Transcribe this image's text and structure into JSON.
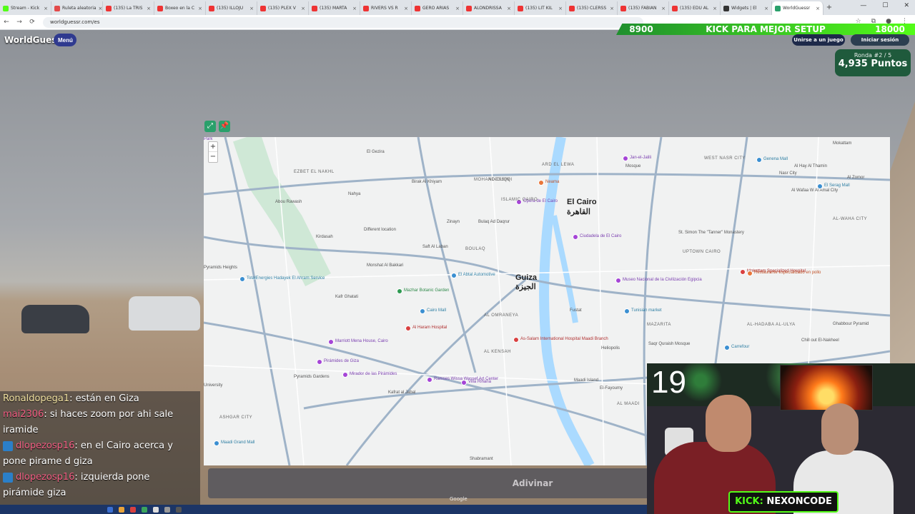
{
  "browser": {
    "tabs": [
      {
        "label": "Stream - Kick",
        "color": "#53fc18"
      },
      {
        "label": "Ruleta aleatoria",
        "color": "#e34a4a"
      },
      {
        "label": "(135) La TRIS",
        "color": "#e33"
      },
      {
        "label": "Boxeo en la C",
        "color": "#e33"
      },
      {
        "label": "(135) ILLOJU",
        "color": "#e33"
      },
      {
        "label": "(135) PLEX V",
        "color": "#e33"
      },
      {
        "label": "(135) MARTA",
        "color": "#e33"
      },
      {
        "label": "RIVERS VS R",
        "color": "#e33"
      },
      {
        "label": "GERO ARIAS",
        "color": "#e33"
      },
      {
        "label": "ALONDRISSA",
        "color": "#e33"
      },
      {
        "label": "(135) LIT KIL",
        "color": "#e33"
      },
      {
        "label": "(135) CLERSS",
        "color": "#e33"
      },
      {
        "label": "(135) FABIAN",
        "color": "#e33"
      },
      {
        "label": "(135) EDU AL",
        "color": "#e33"
      },
      {
        "label": "Widgets | El",
        "color": "#333"
      },
      {
        "label": "WorldGuessr",
        "color": "#2aa06b"
      }
    ],
    "url": "worldguessr.com/es"
  },
  "game": {
    "logo": "WorldGuessr",
    "menu_label": "Menú",
    "join_label": "Unirse a un juego",
    "login_label": "Iniciar sesión",
    "round_label": "Ronda #2 / 5",
    "points": "4,935 Puntos",
    "guess_label": "Adivinar",
    "google": "Google"
  },
  "kick_bar": {
    "left": "8900",
    "text": "KICK PARA MEJOR SETUP",
    "right": "18000"
  },
  "map": {
    "labels": [
      {
        "t": "El Cairo",
        "c": "big"
      },
      {
        "t": "القاهرة",
        "c": "big"
      },
      {
        "t": "Guiza",
        "c": "big"
      },
      {
        "t": "الجيزة",
        "c": "big"
      },
      {
        "t": "EZBET EL NAKHL",
        "c": "district"
      },
      {
        "t": "Abou Rawash",
        "c": ""
      },
      {
        "t": "Nahya",
        "c": ""
      },
      {
        "t": "Birak Al Khiyam",
        "c": ""
      },
      {
        "t": "Kirdasah",
        "c": ""
      },
      {
        "t": "Different location",
        "c": ""
      },
      {
        "t": "Zinayn",
        "c": ""
      },
      {
        "t": "Bulaq Ad Daqrur",
        "c": ""
      },
      {
        "t": "Saft Al Laban",
        "c": ""
      },
      {
        "t": "BOULAQ",
        "c": "district"
      },
      {
        "t": "Monshat Al Bakkari",
        "c": ""
      },
      {
        "t": "Kafr Ghatati",
        "c": ""
      },
      {
        "t": "AL OMRANEYA",
        "c": "district"
      },
      {
        "t": "AL KENSAH",
        "c": "district"
      },
      {
        "t": "Kafrat al Jabal",
        "c": ""
      },
      {
        "t": "Pyramids Gardens",
        "c": ""
      },
      {
        "t": "ASHGAR CITY",
        "c": "district"
      },
      {
        "t": "Shabramant",
        "c": ""
      },
      {
        "t": "Fustat",
        "c": ""
      },
      {
        "t": "MAZARITA",
        "c": "district"
      },
      {
        "t": "AL MAADI",
        "c": "district"
      },
      {
        "t": "Maadi Island",
        "c": ""
      },
      {
        "t": "AL-HADABA AL-ULYA",
        "c": "district"
      },
      {
        "t": "UPTOWN CAIRO",
        "c": "district"
      },
      {
        "t": "WEST NASR CITY",
        "c": "district"
      },
      {
        "t": "Nasr City",
        "c": ""
      },
      {
        "t": "Al Hay Al Thamin",
        "c": ""
      },
      {
        "t": "Al Wafaa W Al Amal City",
        "c": ""
      },
      {
        "t": "AL-WAHA CITY",
        "c": "district"
      },
      {
        "t": "Genena Mall",
        "c": "teal"
      },
      {
        "t": "El Serag Mall",
        "c": "teal"
      },
      {
        "t": "Al Zomor",
        "c": ""
      },
      {
        "t": "St. Simon The \"Tanner\" Monastery",
        "c": ""
      },
      {
        "t": "Mokattam Specialized Hospital",
        "c": "red"
      },
      {
        "t": "Ciudadela de El Cairo",
        "c": "purple"
      },
      {
        "t": "Museo Nacional de la Civilización Egipcia",
        "c": "purple"
      },
      {
        "t": "Tunisian market",
        "c": "teal"
      },
      {
        "t": "Saqr Quraish Mosque",
        "c": ""
      },
      {
        "t": "Carrefour",
        "c": "teal"
      },
      {
        "t": "Chill out El-Nakheel",
        "c": ""
      },
      {
        "t": "Ghabbour Pyramid",
        "c": ""
      },
      {
        "t": "El Abtal Automotive",
        "c": "teal"
      },
      {
        "t": "Cairo Mall",
        "c": "teal"
      },
      {
        "t": "Al Haram Hospital",
        "c": "red"
      },
      {
        "t": "Marriott Mena House, Cairo",
        "c": "purple"
      },
      {
        "t": "Pirámides de Giza",
        "c": "purple"
      },
      {
        "t": "Mirador de las Pirámides",
        "c": "purple"
      },
      {
        "t": "Ramses Wissa Wassef Art Center",
        "c": "purple"
      },
      {
        "t": "Villa Rihana",
        "c": "purple"
      },
      {
        "t": "As-Salam International Hospital Maadi Branch",
        "c": "red"
      },
      {
        "t": "Ópera de El Cairo",
        "c": "purple"
      },
      {
        "t": "Neama",
        "c": "orange"
      },
      {
        "t": "Mosque",
        "c": ""
      },
      {
        "t": "Jan-el-Jalili",
        "c": "purple"
      },
      {
        "t": "ISLAMIC CAIRO",
        "c": "district"
      },
      {
        "t": "AD-DUQQI",
        "c": "district"
      },
      {
        "t": "MOHANDESSIN",
        "c": "district"
      },
      {
        "t": "ARD EL LEWA",
        "c": "district"
      },
      {
        "t": "El Gezira",
        "c": ""
      },
      {
        "t": "Mazhar Botanic Garden",
        "c": "green"
      },
      {
        "t": "Restaurante especializado en pollo",
        "c": "orange"
      },
      {
        "t": "Mokattam",
        "c": ""
      },
      {
        "t": "Heliopolis",
        "c": ""
      },
      {
        "t": "El-Fayoumy",
        "c": ""
      },
      {
        "t": "Maadi Grand Mall",
        "c": "teal"
      },
      {
        "t": "TotalEnergies Hadayek El Ahram Service",
        "c": "teal"
      },
      {
        "t": "Pyramids Heights",
        "c": ""
      },
      {
        "t": "University",
        "c": ""
      },
      {
        "t": "Park",
        "c": "purple"
      }
    ]
  },
  "chat": [
    {
      "user": "Ronaldopega1",
      "msg": ": están en Giza",
      "style": "user2",
      "badge": false
    },
    {
      "user": "mai2306",
      "msg": ": si haces zoom por ahi sale",
      "style": "user",
      "badge": false
    },
    {
      "user": "",
      "msg": "iramide",
      "style": "",
      "badge": false
    },
    {
      "user": "dlopezosp16",
      "msg": ": en el Cairo acerca y",
      "style": "user",
      "badge": true
    },
    {
      "user": "",
      "msg": "pone pirame d giza",
      "style": "",
      "badge": false
    },
    {
      "user": "dlopezosp16",
      "msg": ": izquierda pone",
      "style": "user",
      "badge": true
    },
    {
      "user": "",
      "msg": "pirámide giza",
      "style": "",
      "badge": false
    }
  ],
  "cam": {
    "timer": "19",
    "kick_prefix": "KICK:",
    "kick_name": "NEXONCODE"
  }
}
